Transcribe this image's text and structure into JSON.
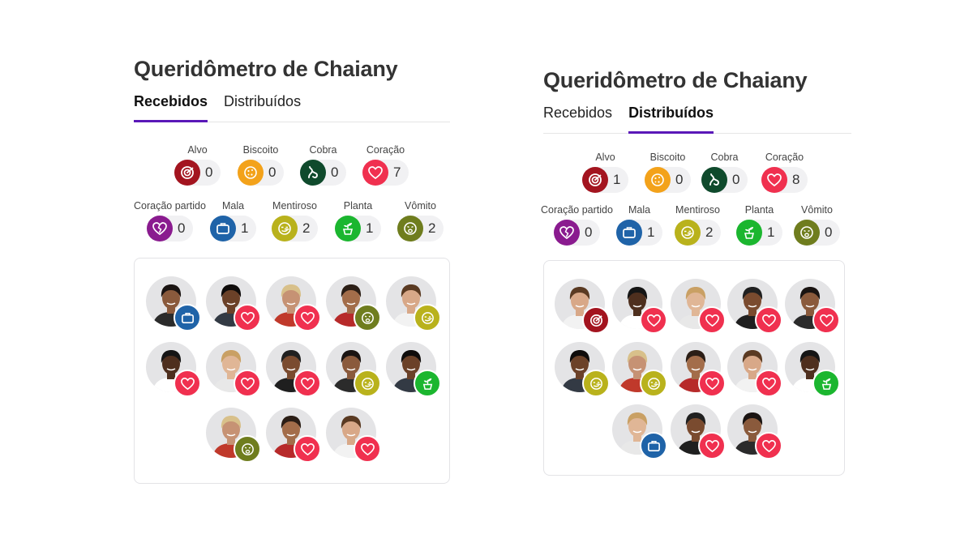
{
  "colors": {
    "tab_indicator": "#5a18b8",
    "alvo": "#a3141f",
    "biscoito": "#f3a21a",
    "cobra": "#0f4a2c",
    "coracao": "#f0304f",
    "coracao_partido": "#8a1b8f",
    "mala": "#1f63a8",
    "mentiroso": "#b9b21c",
    "planta": "#1bb62f",
    "vomito": "#6f7d1e"
  },
  "panels": [
    {
      "title": "Queridômetro de Chaiany",
      "tabs": [
        {
          "label": "Recebidos",
          "active": true
        },
        {
          "label": "Distribuídos",
          "active": false
        }
      ],
      "categories": [
        {
          "label": "Alvo",
          "icon": "target-icon",
          "count": "0"
        },
        {
          "label": "Biscoito",
          "icon": "cookie-icon",
          "count": "0"
        },
        {
          "label": "Cobra",
          "icon": "snake-icon",
          "count": "0"
        },
        {
          "label": "Coração",
          "icon": "heart-icon",
          "count": "7"
        },
        {
          "label": "Coração partido",
          "icon": "broken-heart-icon",
          "count": "0"
        },
        {
          "label": "Mala",
          "icon": "suitcase-icon",
          "count": "1"
        },
        {
          "label": "Mentiroso",
          "icon": "liar-face-icon",
          "count": "2"
        },
        {
          "label": "Planta",
          "icon": "plant-icon",
          "count": "1"
        },
        {
          "label": "Vômito",
          "icon": "vomit-face-icon",
          "count": "2"
        }
      ],
      "avatars": [
        "mala",
        "coracao",
        "coracao",
        "vomito",
        "mentiroso",
        "coracao",
        "coracao",
        "coracao",
        "mentiroso",
        "planta",
        "vomito",
        "coracao",
        "coracao"
      ]
    },
    {
      "title": "Queridômetro de Chaiany",
      "tabs": [
        {
          "label": "Recebidos",
          "active": false
        },
        {
          "label": "Distribuídos",
          "active": true
        }
      ],
      "categories": [
        {
          "label": "Alvo",
          "icon": "target-icon",
          "count": "1"
        },
        {
          "label": "Biscoito",
          "icon": "cookie-icon",
          "count": "0"
        },
        {
          "label": "Cobra",
          "icon": "snake-icon",
          "count": "0"
        },
        {
          "label": "Coração",
          "icon": "heart-icon",
          "count": "8"
        },
        {
          "label": "Coração partido",
          "icon": "broken-heart-icon",
          "count": "0"
        },
        {
          "label": "Mala",
          "icon": "suitcase-icon",
          "count": "1"
        },
        {
          "label": "Mentiroso",
          "icon": "liar-face-icon",
          "count": "2"
        },
        {
          "label": "Planta",
          "icon": "plant-icon",
          "count": "1"
        },
        {
          "label": "Vômito",
          "icon": "vomit-face-icon",
          "count": "0"
        }
      ],
      "avatars": [
        "alvo",
        "coracao",
        "coracao",
        "coracao",
        "coracao",
        "mentiroso",
        "mentiroso",
        "coracao",
        "coracao",
        "planta",
        "mala",
        "coracao",
        "coracao"
      ]
    }
  ]
}
